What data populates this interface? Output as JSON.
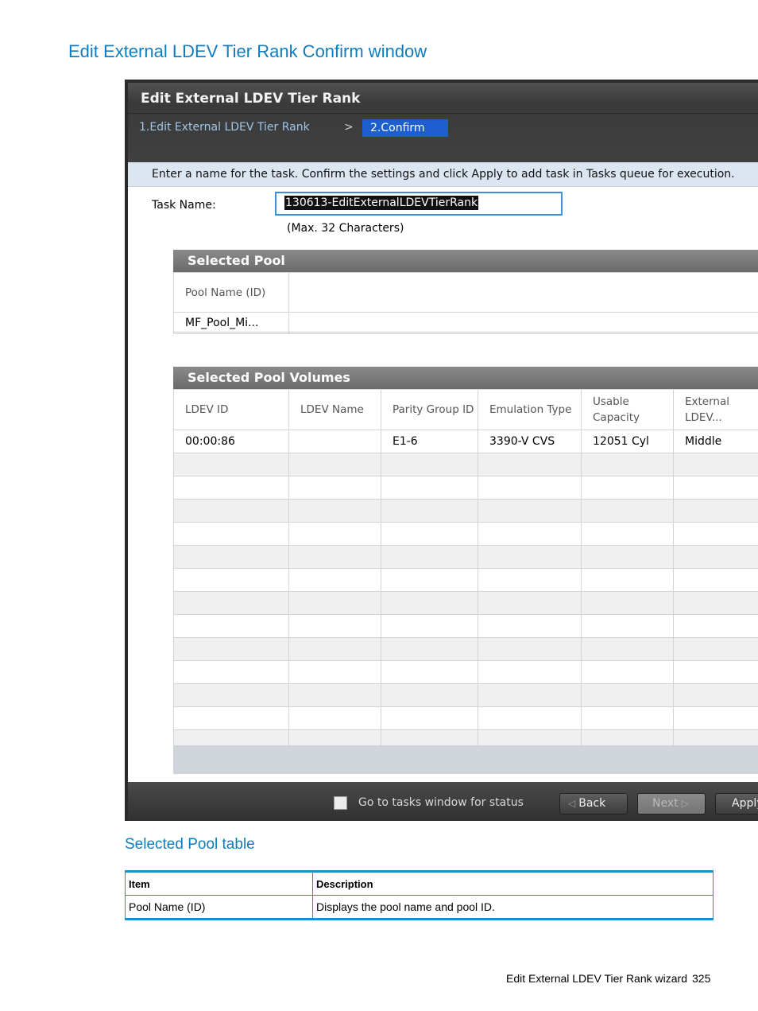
{
  "doc": {
    "title": "Edit External LDEV Tier Rank Confirm window",
    "section_title": "Selected Pool table",
    "footer_text": "Edit External LDEV Tier Rank wizard",
    "page_number": "325"
  },
  "window": {
    "title": "Edit External LDEV Tier Rank",
    "steps": {
      "step1": "1.Edit External LDEV Tier Rank",
      "separator": ">",
      "step2": "2.Confirm"
    },
    "instruction": "Enter a name for the task. Confirm the settings and click Apply to add task in Tasks queue for execution.",
    "task_name": {
      "label": "Task Name:",
      "value": "130613-EditExternalLDEVTierRank",
      "hint": "(Max. 32 Characters)"
    },
    "selected_pool": {
      "title": "Selected Pool",
      "header": "Pool Name (ID)",
      "value": "MF_Pool_Mi..."
    },
    "selected_pool_volumes": {
      "title": "Selected Pool Volumes",
      "columns": [
        "LDEV ID",
        "LDEV Name",
        "Parity Group ID",
        "Emulation Type",
        "Usable Capacity",
        "External LDEV..."
      ],
      "rows": [
        [
          "00:00:86",
          "",
          "E1-6",
          "3390-V CVS",
          "12051 Cyl",
          "Middle"
        ]
      ]
    },
    "footer": {
      "checkbox_label": "Go to tasks window for status",
      "back_label": "Back",
      "next_label": "Next",
      "apply_label": "Apply"
    }
  },
  "desc_table": {
    "headers": [
      "Item",
      "Description"
    ],
    "rows": [
      [
        "Pool Name (ID)",
        "Displays the pool name and pool ID."
      ]
    ]
  }
}
